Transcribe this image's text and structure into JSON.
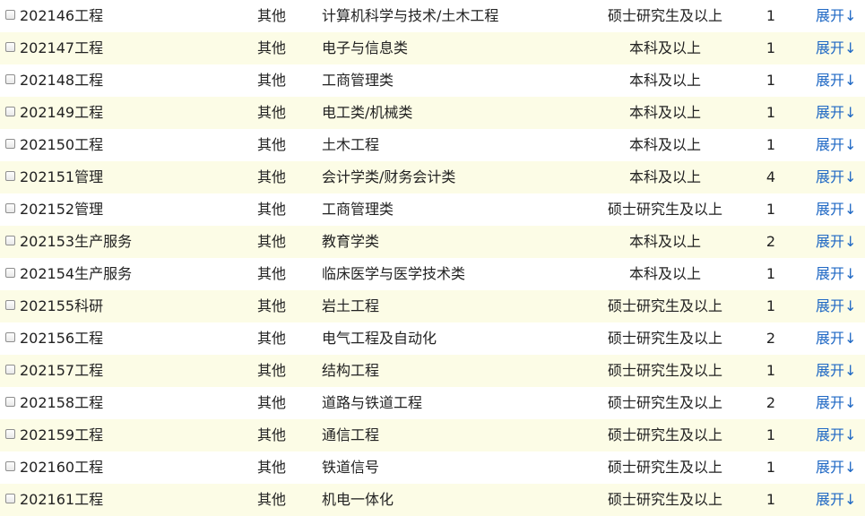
{
  "expand_label": "展开↓",
  "rows": [
    {
      "post": "202146工程",
      "type": "其他",
      "major": "计算机科学与技术/土木工程",
      "education": "硕士研究生及以上",
      "count": "1"
    },
    {
      "post": "202147工程",
      "type": "其他",
      "major": "电子与信息类",
      "education": "本科及以上",
      "count": "1"
    },
    {
      "post": "202148工程",
      "type": "其他",
      "major": "工商管理类",
      "education": "本科及以上",
      "count": "1"
    },
    {
      "post": "202149工程",
      "type": "其他",
      "major": "电工类/机械类",
      "education": "本科及以上",
      "count": "1"
    },
    {
      "post": "202150工程",
      "type": "其他",
      "major": "土木工程",
      "education": "本科及以上",
      "count": "1"
    },
    {
      "post": "202151管理",
      "type": "其他",
      "major": "会计学类/财务会计类",
      "education": "本科及以上",
      "count": "4"
    },
    {
      "post": "202152管理",
      "type": "其他",
      "major": "工商管理类",
      "education": "硕士研究生及以上",
      "count": "1"
    },
    {
      "post": "202153生产服务",
      "type": "其他",
      "major": "教育学类",
      "education": "本科及以上",
      "count": "2"
    },
    {
      "post": "202154生产服务",
      "type": "其他",
      "major": "临床医学与医学技术类",
      "education": "本科及以上",
      "count": "1"
    },
    {
      "post": "202155科研",
      "type": "其他",
      "major": "岩土工程",
      "education": "硕士研究生及以上",
      "count": "1"
    },
    {
      "post": "202156工程",
      "type": "其他",
      "major": "电气工程及自动化",
      "education": "硕士研究生及以上",
      "count": "2"
    },
    {
      "post": "202157工程",
      "type": "其他",
      "major": "结构工程",
      "education": "硕士研究生及以上",
      "count": "1"
    },
    {
      "post": "202158工程",
      "type": "其他",
      "major": "道路与铁道工程",
      "education": "硕士研究生及以上",
      "count": "2"
    },
    {
      "post": "202159工程",
      "type": "其他",
      "major": "通信工程",
      "education": "硕士研究生及以上",
      "count": "1"
    },
    {
      "post": "202160工程",
      "type": "其他",
      "major": "铁道信号",
      "education": "硕士研究生及以上",
      "count": "1"
    },
    {
      "post": "202161工程",
      "type": "其他",
      "major": "机电一体化",
      "education": "硕士研究生及以上",
      "count": "1"
    }
  ]
}
